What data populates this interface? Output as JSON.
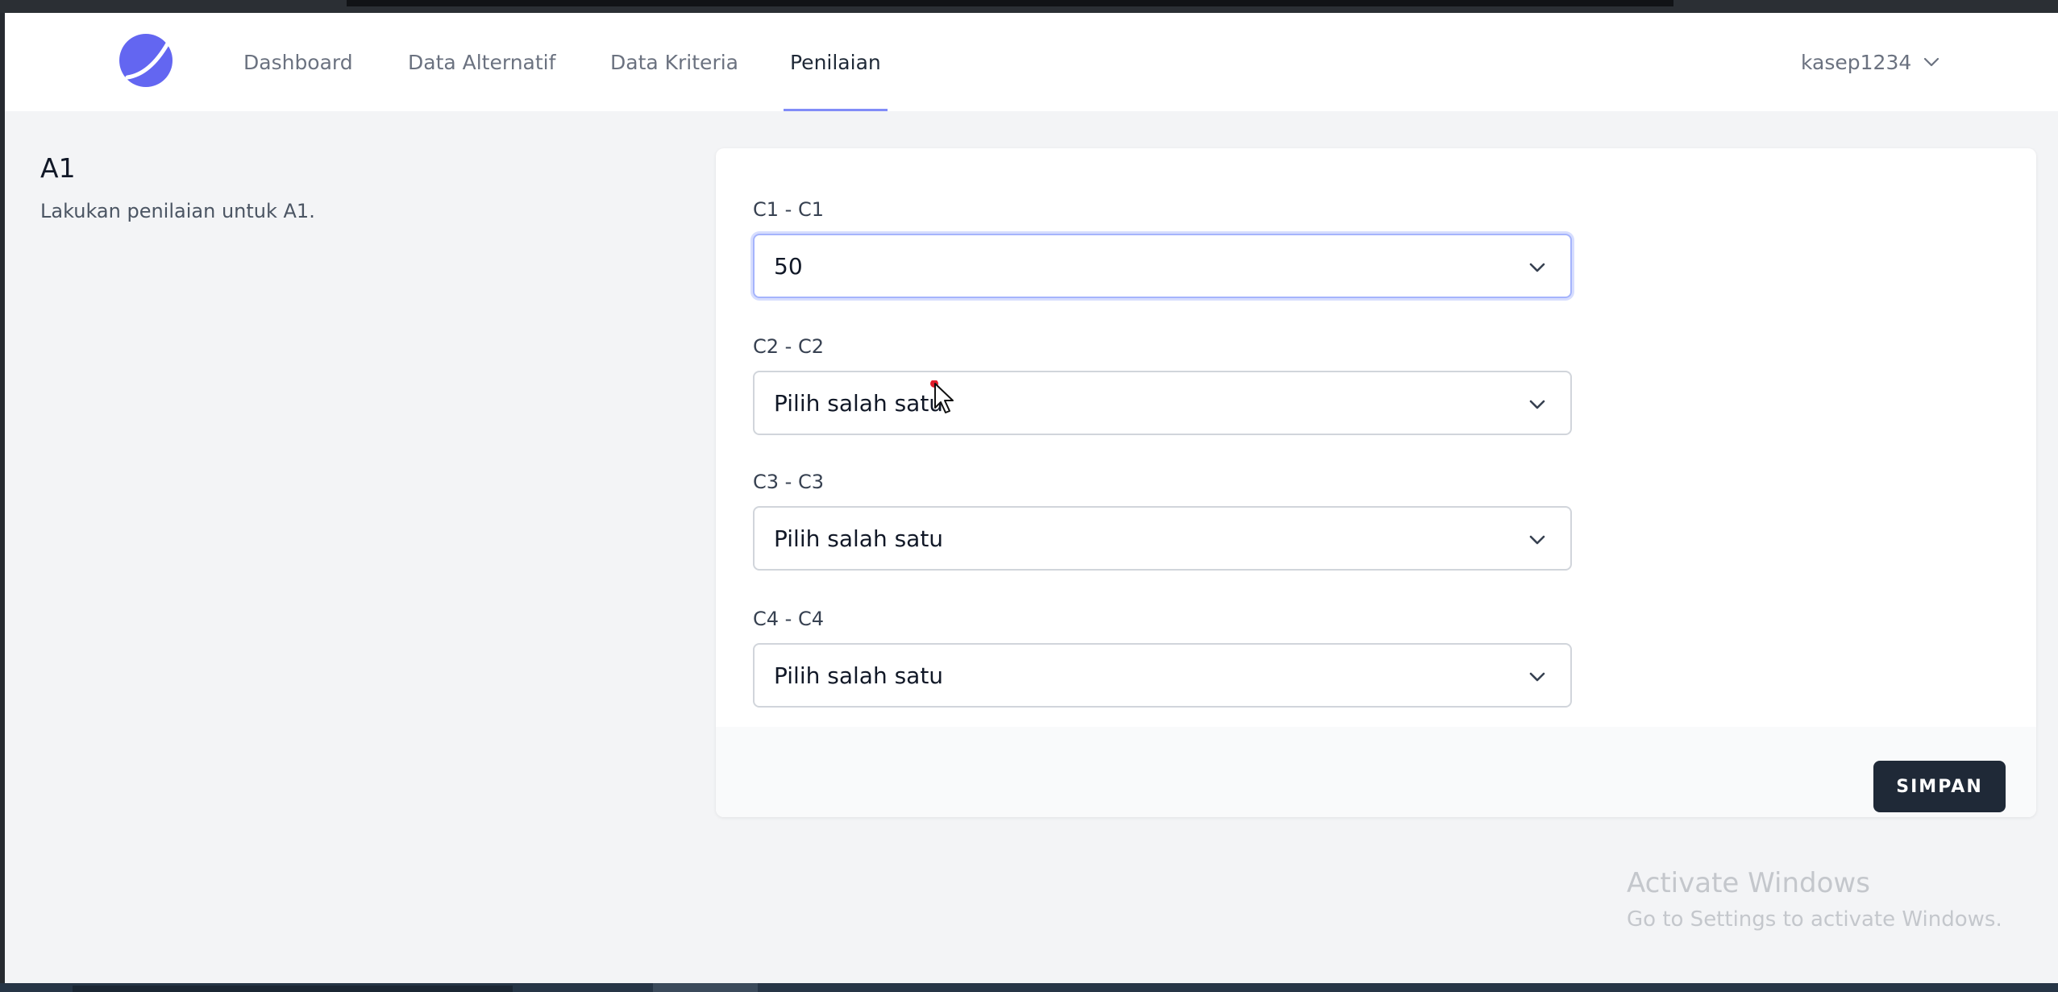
{
  "navbar": {
    "links": [
      {
        "label": "Dashboard"
      },
      {
        "label": "Data Alternatif"
      },
      {
        "label": "Data Kriteria"
      },
      {
        "label": "Penilaian"
      }
    ],
    "active_index": 3,
    "user": "kasep1234"
  },
  "section": {
    "title": "A1",
    "description": "Lakukan penilaian untuk A1."
  },
  "form": {
    "fields": [
      {
        "label": "C1 - C1",
        "value": "50"
      },
      {
        "label": "C2 - C2",
        "value": "Pilih salah satu"
      },
      {
        "label": "C3 - C3",
        "value": "Pilih salah satu"
      },
      {
        "label": "C4 - C4",
        "value": "Pilih salah satu"
      }
    ],
    "submit_label": "SIMPAN"
  },
  "watermark": {
    "title": "Activate Windows",
    "subtitle": "Go to Settings to activate Windows."
  },
  "colors": {
    "accent": "#818cf8",
    "logo": "#6366f1",
    "button": "#1f2937",
    "background": "#f3f4f6"
  }
}
